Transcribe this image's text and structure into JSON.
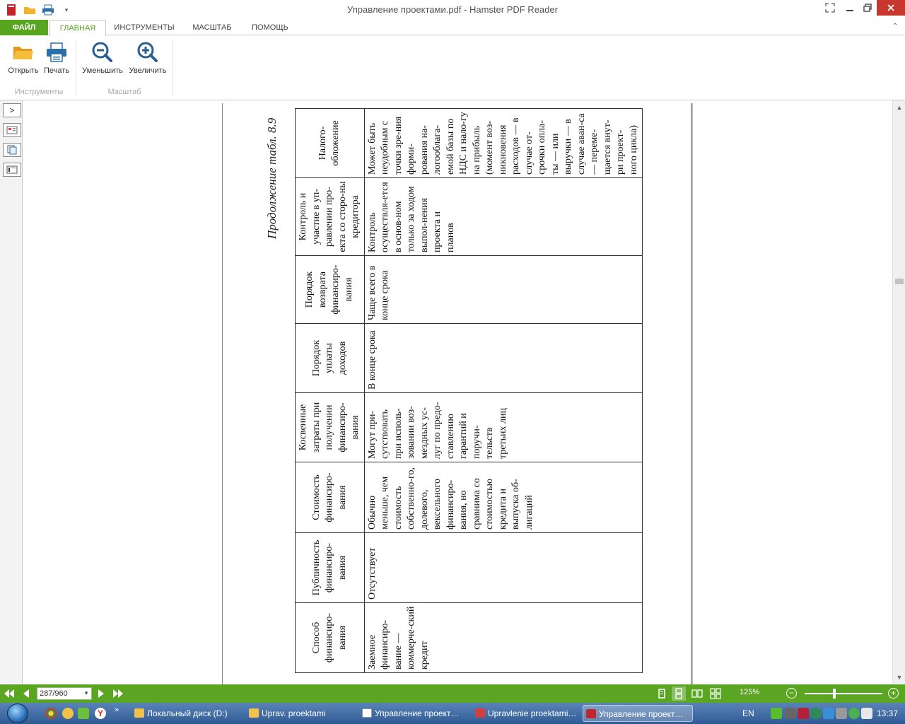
{
  "window": {
    "title": "Управление проектами.pdf - Hamster PDF Reader"
  },
  "ribbon": {
    "tabs": [
      "ФАЙЛ",
      "ГЛАВНАЯ",
      "ИНСТРУМЕНТЫ",
      "МАСШТАБ",
      "ПОМОЩЬ"
    ],
    "active_tab": "ГЛАВНАЯ",
    "buttons": {
      "open": "Открыть",
      "print": "Печать",
      "zoom_out": "Уменьшить",
      "zoom_in": "Увеличить"
    },
    "groups": {
      "tools": "Инструменты",
      "scale": "Масштаб"
    }
  },
  "document": {
    "caption": "Продолжение табл. 8.9",
    "table": {
      "headers": [
        "Способ финансиро-вания",
        "Публичность финансиро-вания",
        "Стоимость финансиро-вания",
        "Косвенные затраты при получении финансиро-вания",
        "Порядок уплаты доходов",
        "Порядок возврата финансиро-вания",
        "Контроль и участие в уп-равлении про-екта со сторо-ны кредитора",
        "Налого-обложение"
      ],
      "row": [
        "Заемное финансиро-вание — коммерче-ский кредит",
        "Отсутствует",
        "Обычно меньше, чем стоимость собственно-го, долевого, вексельного финансиро-вания, но сравнима со стоимостью кредита и выпуска об-лигаций",
        "Могут при-сутствовать при исполь-зовании воз-мездных ус-луг по предо-ставлению гарантий и поручи-тельств третьих лиц",
        "В конце срока",
        "Чаще всего в конце срока",
        "Контроль осуществля-ется в основ-ном только за ходом выпол-нения проекта и планов",
        "Может быть неудобным с точки зре-ния форми-рования на-логооблага-емой базы по НДС и нало-гу на прибыль (момент воз-никновения расходов — в случае от-срочки опла-ты — или выручки — в случае аван-са — переме-щается внут-ри проект-ного цикла)"
      ]
    }
  },
  "statusbar": {
    "page_field": "287/960",
    "zoom": "125%",
    "zoom_fraction": 0.38
  },
  "taskbar": {
    "items": [
      "Локальный диск (D:)",
      "Uprav. proektami",
      "Управление проект…",
      "Upravlenie proektami…",
      "Управление проект…"
    ],
    "language": "EN",
    "time": "13:37"
  },
  "colors": {
    "accent_green": "#58a520",
    "close_red": "#c7372f",
    "taskbar_blue": "#2f5a94"
  }
}
